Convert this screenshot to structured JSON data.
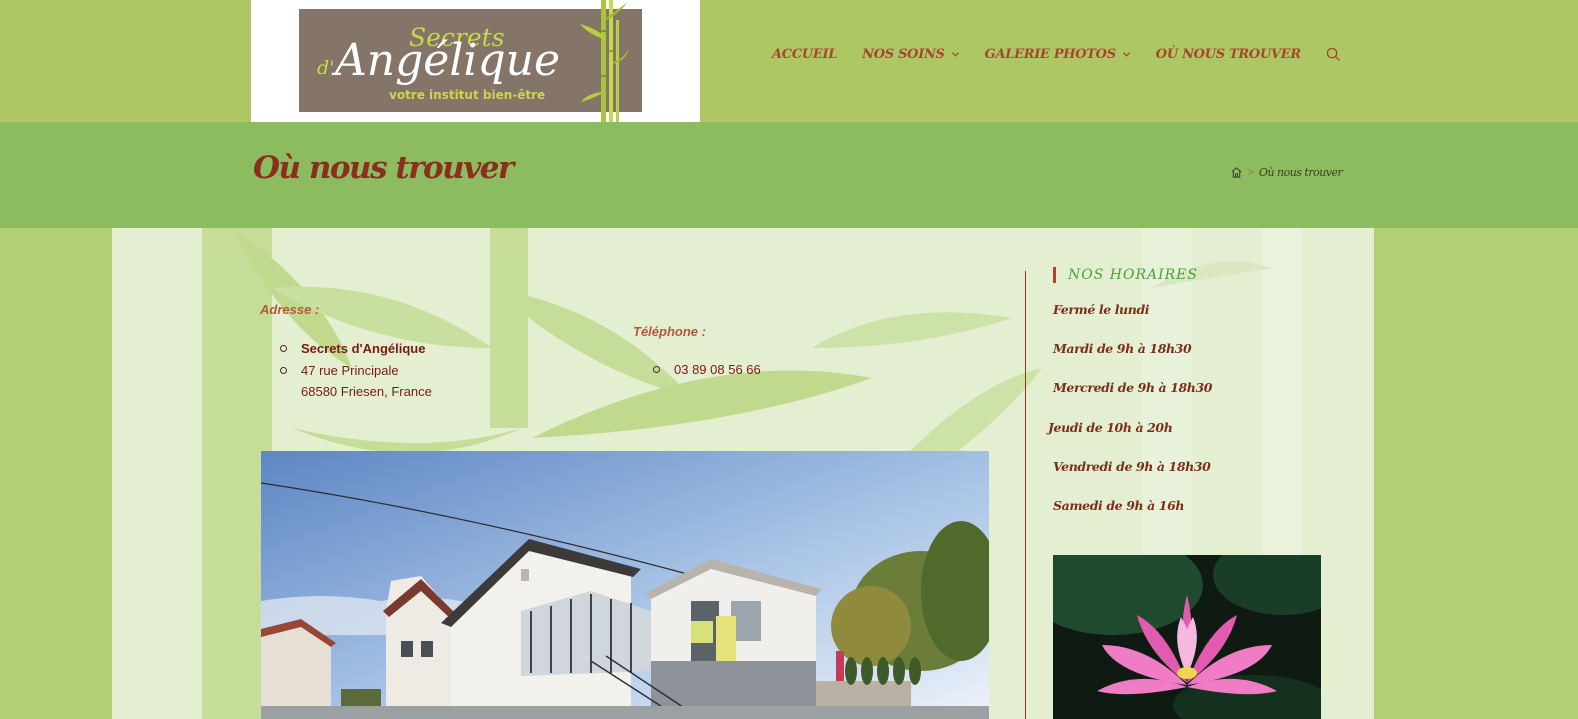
{
  "logo": {
    "word_secrets": "Secrets",
    "word_d": "d'",
    "word_angelique": "Angélique",
    "tagline": "votre institut bien-être"
  },
  "nav": {
    "items": [
      {
        "label": "ACCUEIL",
        "has_dropdown": false
      },
      {
        "label": "NOS SOINS",
        "has_dropdown": true
      },
      {
        "label": "GALERIE PHOTOS",
        "has_dropdown": true
      },
      {
        "label": "OÙ NOUS TROUVER",
        "has_dropdown": false
      }
    ],
    "search_icon": "search-icon"
  },
  "page": {
    "title": "Où nous trouver",
    "breadcrumb": {
      "home_icon": "home-icon",
      "separator": ">",
      "current": "Où nous trouver"
    }
  },
  "address": {
    "label": "Adresse :",
    "name": "Secrets d'Angélique",
    "street": "47 rue Principale",
    "city": "68580 Friesen, France"
  },
  "phone": {
    "label": "Téléphone :",
    "number": "03 89 08 56 66"
  },
  "sidebar": {
    "title": "NOS HORAIRES",
    "hours": [
      "Fermé le lundi",
      "Mardi de 9h à 18h30",
      "Mercredi de 9h à 18h30",
      "Jeudi de 10h à 20h",
      "Vendredi de 9h à 18h30",
      "Samedi de 9h à 16h"
    ]
  },
  "colors": {
    "header_bg": "#aec765",
    "title_band": "#8dbb5f",
    "nav_text": "#a7472a",
    "title_text": "#8c2e1d",
    "sidebar_title": "#4aa138"
  }
}
